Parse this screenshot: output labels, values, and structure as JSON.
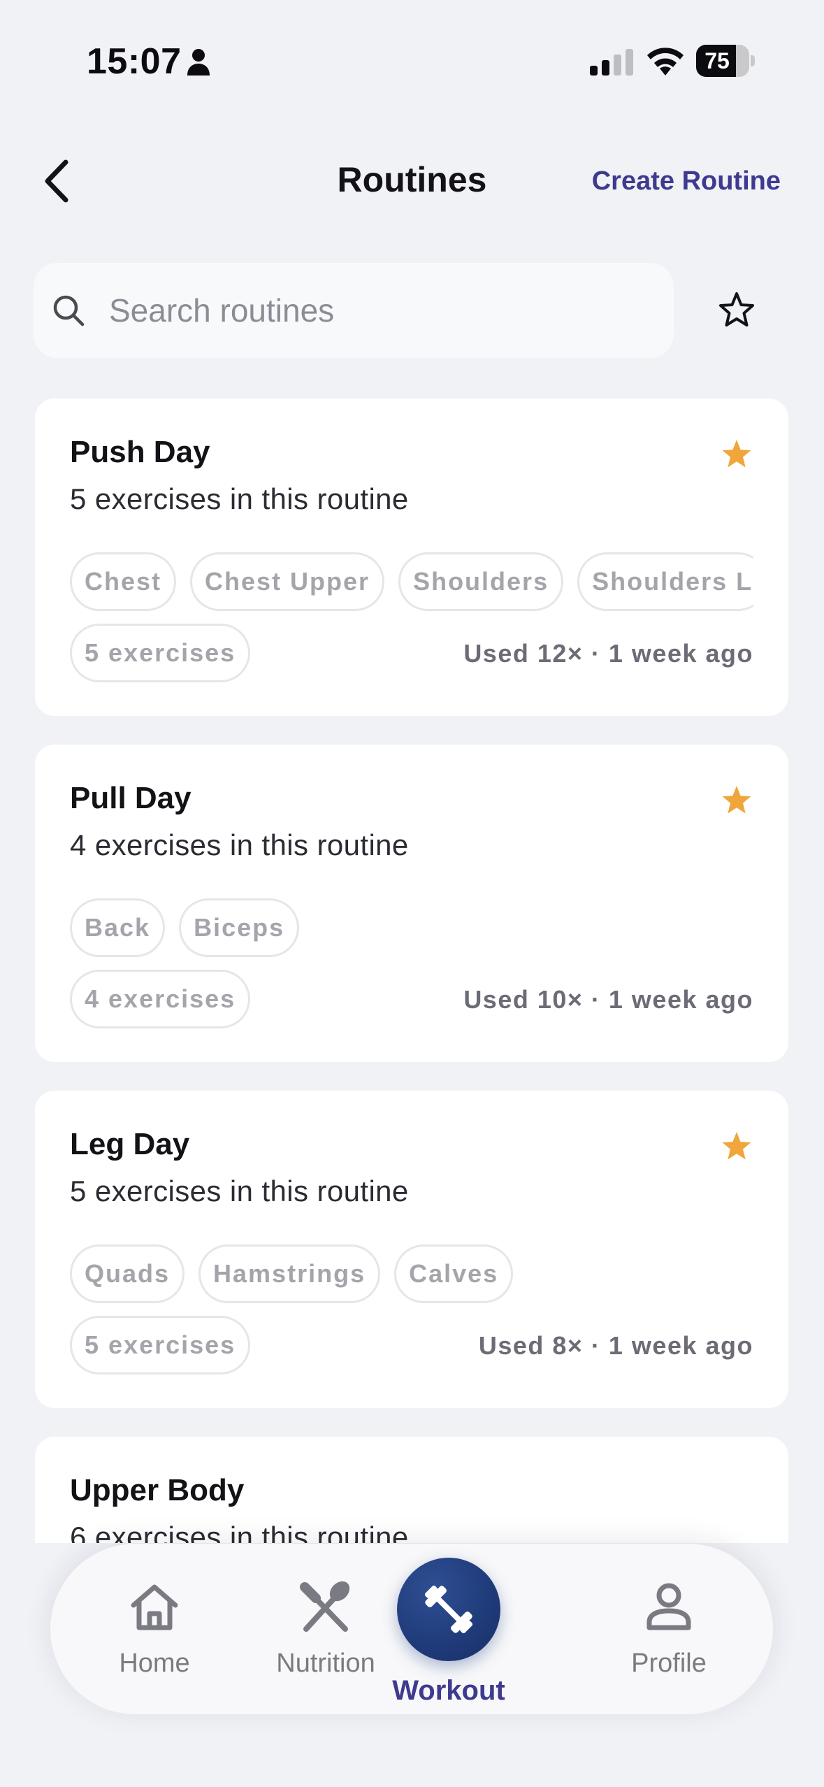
{
  "status_bar": {
    "time": "15:07",
    "battery": "75",
    "battery_level": 0.75
  },
  "header": {
    "title": "Routines",
    "create_label": "Create Routine"
  },
  "search": {
    "placeholder": "Search routines",
    "value": ""
  },
  "colors": {
    "accent": "#3d3a8f",
    "star": "#f0a63a",
    "workout_button": "#1f3a78",
    "background": "#f1f2f6"
  },
  "routines": [
    {
      "title": "Push Day",
      "subtitle": "5 exercises in this routine",
      "tags": [
        "Chest",
        "Chest Upper",
        "Shoulders",
        "Shoulders L"
      ],
      "count_tag": "5 exercises",
      "usage": "Used 12× · 1 week ago",
      "favorite": true
    },
    {
      "title": "Pull Day",
      "subtitle": "4 exercises in this routine",
      "tags": [
        "Back",
        "Biceps"
      ],
      "count_tag": "4 exercises",
      "usage": "Used 10× · 1 week ago",
      "favorite": true
    },
    {
      "title": "Leg Day",
      "subtitle": "5 exercises in this routine",
      "tags": [
        "Quads",
        "Hamstrings",
        "Calves"
      ],
      "count_tag": "5 exercises",
      "usage": "Used 8× · 1 week ago",
      "favorite": true
    },
    {
      "title": "Upper Body",
      "subtitle": "6 exercises in this routine"
    }
  ],
  "nav": {
    "home": "Home",
    "nutrition": "Nutrition",
    "workout": "Workout",
    "profile": "Profile",
    "active": "workout"
  }
}
